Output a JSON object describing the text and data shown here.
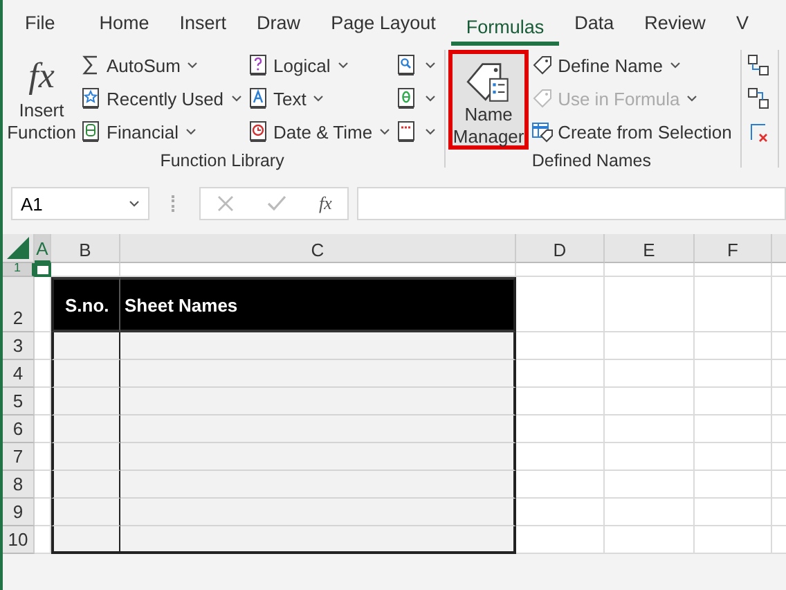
{
  "tabs": [
    {
      "label": "File",
      "selected": false
    },
    {
      "label": "Home",
      "selected": false
    },
    {
      "label": "Insert",
      "selected": false
    },
    {
      "label": "Draw",
      "selected": false
    },
    {
      "label": "Page Layout",
      "selected": false
    },
    {
      "label": "Formulas",
      "selected": true
    },
    {
      "label": "Data",
      "selected": false
    },
    {
      "label": "Review",
      "selected": false
    },
    {
      "label": "V",
      "selected": false
    }
  ],
  "ribbon_groups": [
    {
      "label": "Function Library",
      "columns": [
        [
          {
            "kind": "large",
            "symbol": "fx",
            "label": "Insert Function",
            "highlighted": false
          }
        ],
        [
          {
            "kind": "small",
            "label": "AutoSum",
            "dropdown": true,
            "disabled": false
          },
          {
            "kind": "small",
            "label": "Recently Used",
            "dropdown": true,
            "disabled": false
          },
          {
            "kind": "small",
            "label": "Financial",
            "dropdown": true,
            "disabled": false
          }
        ],
        [
          {
            "kind": "small",
            "label": "Logical",
            "dropdown": true,
            "disabled": false
          },
          {
            "kind": "small",
            "label": "Text",
            "dropdown": true,
            "disabled": false
          },
          {
            "kind": "small",
            "label": "Date & Time",
            "dropdown": true,
            "disabled": false
          }
        ],
        [
          {
            "kind": "icon",
            "dropdown": true
          },
          {
            "kind": "icon",
            "dropdown": true
          },
          {
            "kind": "icon",
            "dropdown": true
          }
        ]
      ]
    },
    {
      "label": "Defined Names",
      "columns": [
        [
          {
            "kind": "large",
            "label": "Name Manager",
            "highlighted": true
          }
        ],
        [
          {
            "kind": "small",
            "label": "Define Name",
            "dropdown": true,
            "disabled": false
          },
          {
            "kind": "small",
            "label": "Use in Formula",
            "dropdown": true,
            "disabled": true
          },
          {
            "kind": "small",
            "label": "Create from Selection",
            "dropdown": false,
            "disabled": false
          }
        ]
      ]
    },
    {
      "columns": [
        [
          {
            "kind": "icon"
          },
          {
            "kind": "icon"
          },
          {
            "kind": "icon"
          }
        ]
      ]
    }
  ],
  "formula_bar": {
    "name_box": "A1",
    "fx": "fx"
  },
  "sheet": {
    "columns": [
      {
        "label": "A",
        "selected": true
      },
      {
        "label": "B",
        "selected": false
      },
      {
        "label": "C",
        "selected": false
      },
      {
        "label": "D",
        "selected": false
      },
      {
        "label": "E",
        "selected": false
      },
      {
        "label": "F",
        "selected": false
      }
    ],
    "rows": [
      {
        "label": "1",
        "selected": true
      },
      {
        "label": "2",
        "selected": false
      },
      {
        "label": "3",
        "selected": false
      },
      {
        "label": "4",
        "selected": false
      },
      {
        "label": "5",
        "selected": false
      },
      {
        "label": "6",
        "selected": false
      },
      {
        "label": "7",
        "selected": false
      },
      {
        "label": "8",
        "selected": false
      },
      {
        "label": "9",
        "selected": false
      },
      {
        "label": "10",
        "selected": false
      }
    ],
    "table": {
      "headers": [
        "S.no.",
        "Sheet Names"
      ]
    }
  }
}
